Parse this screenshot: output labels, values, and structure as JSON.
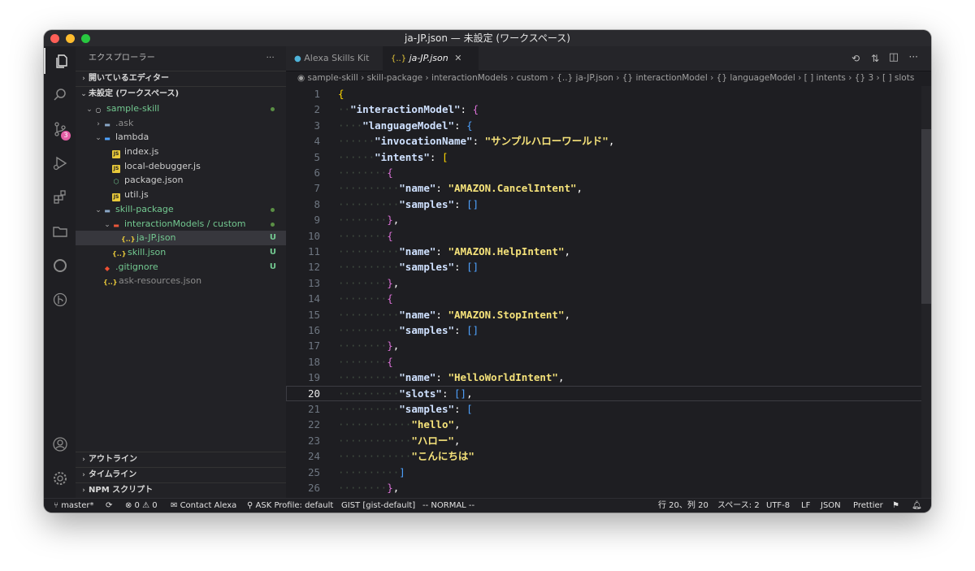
{
  "window": {
    "title": "ja-JP.json — 未設定 (ワークスペース)"
  },
  "traffic_lights": {
    "close": "#ff5f57",
    "minimize": "#febc2e",
    "maximize": "#28c840"
  },
  "activity_bar": {
    "items": [
      "files-icon",
      "search-icon",
      "source-control-icon",
      "run-debug-icon",
      "extensions-icon",
      "folder-icon",
      "alexa-icon",
      "gitlens-icon"
    ],
    "badge": "3",
    "bottom": [
      "account-icon",
      "settings-gear-icon"
    ]
  },
  "sidebar": {
    "title": "エクスプローラー",
    "more": "···",
    "open_editors": "開いているエディター",
    "workspace": "未設定 (ワークスペース)",
    "tree": [
      {
        "label": "sample-skill",
        "depth": 1,
        "kind": "root",
        "color": "#73c991",
        "status": "dot"
      },
      {
        "label": ".ask",
        "depth": 2,
        "kind": "folder",
        "color": "#8b8b8b",
        "status": ""
      },
      {
        "label": "lambda",
        "depth": 2,
        "kind": "folder-open",
        "color": "#cccccc",
        "status": ""
      },
      {
        "label": "index.js",
        "depth": 3,
        "kind": "js",
        "color": "#cccccc",
        "status": ""
      },
      {
        "label": "local-debugger.js",
        "depth": 3,
        "kind": "js",
        "color": "#cccccc",
        "status": ""
      },
      {
        "label": "package.json",
        "depth": 3,
        "kind": "npm",
        "color": "#cccccc",
        "status": ""
      },
      {
        "label": "util.js",
        "depth": 3,
        "kind": "js",
        "color": "#cccccc",
        "status": ""
      },
      {
        "label": "skill-package",
        "depth": 2,
        "kind": "folder-open",
        "color": "#73c991",
        "status": "dot"
      },
      {
        "label": "interactionModels / custom",
        "depth": 3,
        "kind": "folder-open",
        "color": "#73c991",
        "status": "dot"
      },
      {
        "label": "ja-JP.json",
        "depth": 4,
        "kind": "json",
        "color": "#73c991",
        "status": "U",
        "selected": true
      },
      {
        "label": "skill.json",
        "depth": 3,
        "kind": "json",
        "color": "#73c991",
        "status": "U"
      },
      {
        "label": ".gitignore",
        "depth": 2,
        "kind": "git",
        "color": "#73c991",
        "status": "U"
      },
      {
        "label": "ask-resources.json",
        "depth": 2,
        "kind": "json",
        "color": "#8b8b8b",
        "status": ""
      }
    ],
    "bottom_sections": [
      "アウトライン",
      "タイムライン",
      "NPM スクリプト"
    ]
  },
  "tabs": [
    {
      "label": "Alexa Skills Kit",
      "active": false
    },
    {
      "label": "ja-JP.json",
      "active": true
    }
  ],
  "breadcrumbs": [
    "sample-skill",
    "skill-package",
    "interactionModels",
    "custom",
    "{..} ja-JP.json",
    "{} interactionModel",
    "{} languageModel",
    "[ ] intents",
    "{} 3",
    "[ ] slots"
  ],
  "code": {
    "current_line": 20,
    "lines": [
      "{",
      "  \"interactionModel\": {",
      "    \"languageModel\": {",
      "      \"invocationName\": \"サンプルハローワールド\",",
      "      \"intents\": [",
      "        {",
      "          \"name\": \"AMAZON.CancelIntent\",",
      "          \"samples\": []",
      "        },",
      "        {",
      "          \"name\": \"AMAZON.HelpIntent\",",
      "          \"samples\": []",
      "        },",
      "        {",
      "          \"name\": \"AMAZON.StopIntent\",",
      "          \"samples\": []",
      "        },",
      "        {",
      "          \"name\": \"HelloWorldIntent\",",
      "          \"slots\": [],",
      "          \"samples\": [",
      "            \"hello\",",
      "            \"ハロー\",",
      "            \"こんにちは\"",
      "          ]",
      "        },",
      "        {"
    ]
  },
  "status_bar": {
    "branch": "master*",
    "sync": "⟳",
    "problems": "⊗ 0 ⚠ 0",
    "contact": "Contact Alexa",
    "ask_profile": "ASK Profile: default",
    "gist": "GIST [gist-default]",
    "mode": "-- NORMAL --",
    "position": "行 20、列 20",
    "spaces": "スペース: 2",
    "encoding": "UTF-8",
    "eol": "LF",
    "language": "JSON",
    "formatter": "Prettier"
  }
}
